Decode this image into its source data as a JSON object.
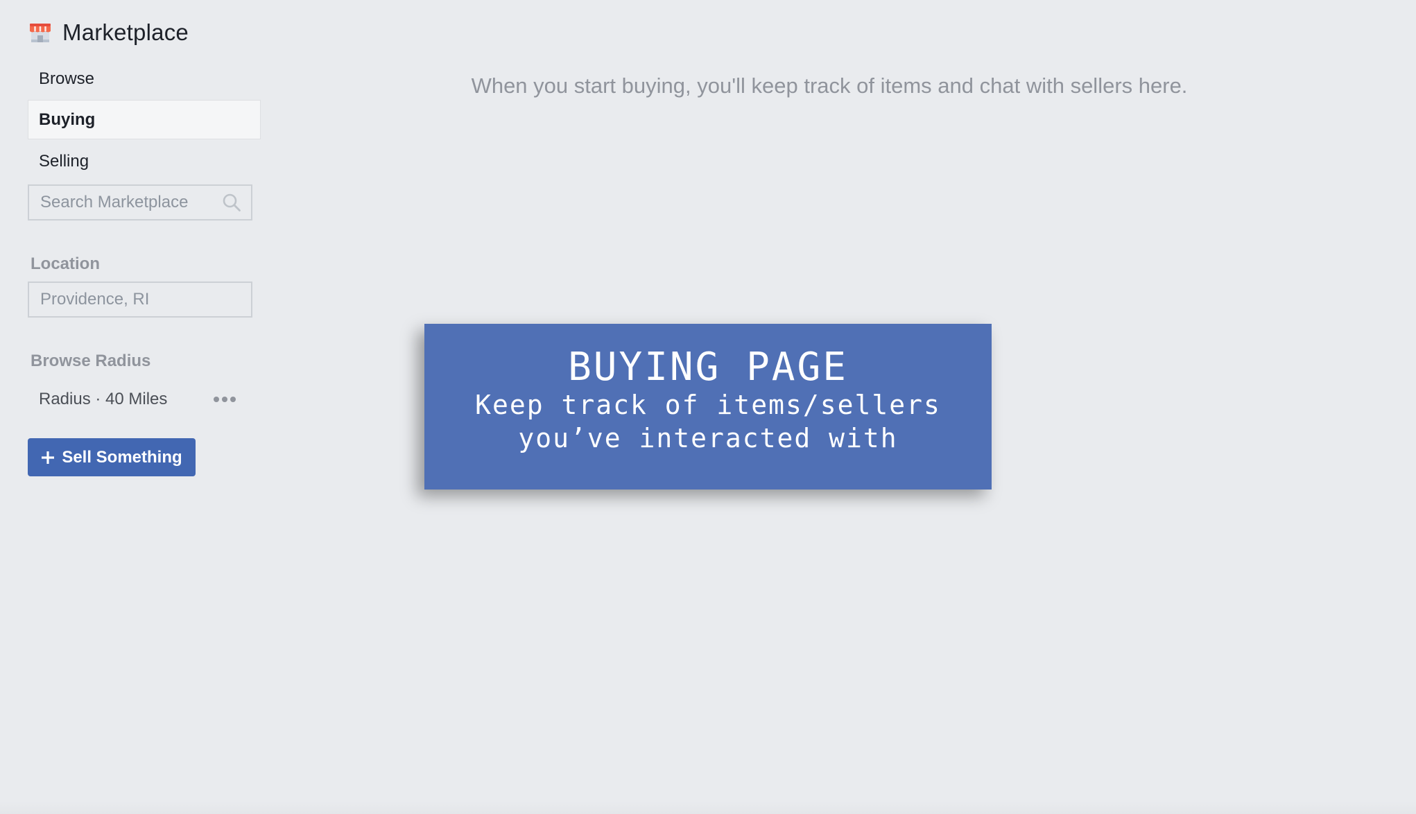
{
  "app": {
    "title": "Marketplace",
    "icon": "storefront-icon"
  },
  "nav": {
    "items": [
      {
        "label": "Browse",
        "active": false
      },
      {
        "label": "Buying",
        "active": true
      },
      {
        "label": "Selling",
        "active": false
      }
    ]
  },
  "search": {
    "placeholder": "Search Marketplace",
    "value": "",
    "icon": "search-icon"
  },
  "location": {
    "label": "Location",
    "value": "Providence, RI"
  },
  "radius": {
    "label": "Browse Radius",
    "value": "Radius · 40 Miles",
    "more_icon": "more-horizontal-icon"
  },
  "sell_button": {
    "label": "Sell Something",
    "icon": "plus-icon"
  },
  "main": {
    "empty_message": "When you start buying, you'll keep track of items and chat with sellers here."
  },
  "overlay": {
    "title": "BUYING PAGE",
    "subtitle_line1": "Keep track of items/sellers",
    "subtitle_line2": "you’ve interacted with"
  },
  "colors": {
    "background": "#e9ebee",
    "primary": "#4267b2",
    "overlay": "#5070b5",
    "muted_text": "#90949c",
    "store_awning": "#f4694b"
  }
}
